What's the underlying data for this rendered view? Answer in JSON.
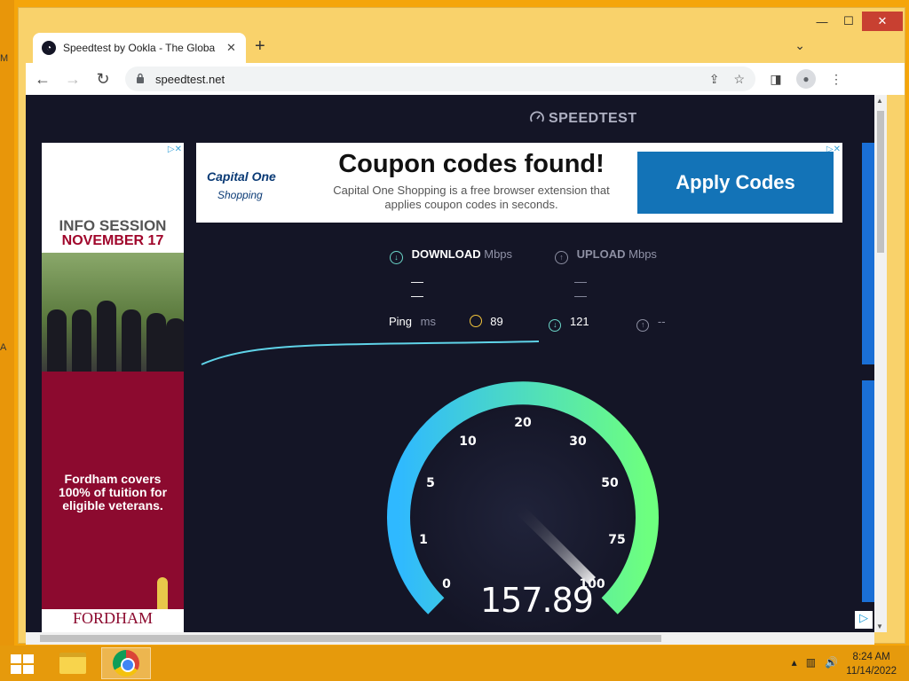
{
  "desktop": {
    "letters": [
      "M",
      "A"
    ]
  },
  "window": {
    "controls": {
      "minimize": "—",
      "maximize": "☐",
      "close": "✕"
    }
  },
  "tab": {
    "title": "Speedtest by Ookla - The Global Broadband Speed Test",
    "close": "✕",
    "new_tab": "+",
    "tab_search": "⌄"
  },
  "toolbar": {
    "back": "←",
    "forward": "→",
    "reload": "↻",
    "url": "speedtest.net",
    "lock": "🔒"
  },
  "page": {
    "logo": "SPEEDTEST",
    "ad_left": {
      "choice": "▷✕",
      "info": "INFO SESSION",
      "date": "NOVEMBER 17",
      "copy": "Fordham covers 100% of tuition for eligible veterans.",
      "brand": "FORDHAM"
    },
    "ad_top": {
      "choice": "▷✕",
      "logo": "Capital One",
      "logo_sub": "Shopping",
      "headline": "Coupon codes found!",
      "subtext": "Capital One Shopping is a free browser extension that applies coupon codes in seconds.",
      "button": "Apply Codes"
    },
    "ad_right_choice": "▷",
    "download": {
      "label": "DOWNLOAD",
      "unit": "Mbps",
      "value": "— —"
    },
    "upload": {
      "label": "UPLOAD",
      "unit": "Mbps",
      "value": "— —"
    },
    "ping": {
      "label": "Ping",
      "unit": "ms",
      "idle": "89",
      "down": "121",
      "up": "--"
    },
    "gauge": {
      "ticks": [
        "0",
        "1",
        "5",
        "10",
        "20",
        "30",
        "50",
        "75",
        "100"
      ],
      "value": "157.89",
      "accent_start": "#2fb9ff",
      "accent_end": "#6dff7f"
    }
  },
  "taskbar": {
    "time": "8:24 AM",
    "date": "11/14/2022"
  },
  "colors": {
    "page_bg": "#141526",
    "desktop": "#f5a50a",
    "close_red": "#c84031"
  }
}
